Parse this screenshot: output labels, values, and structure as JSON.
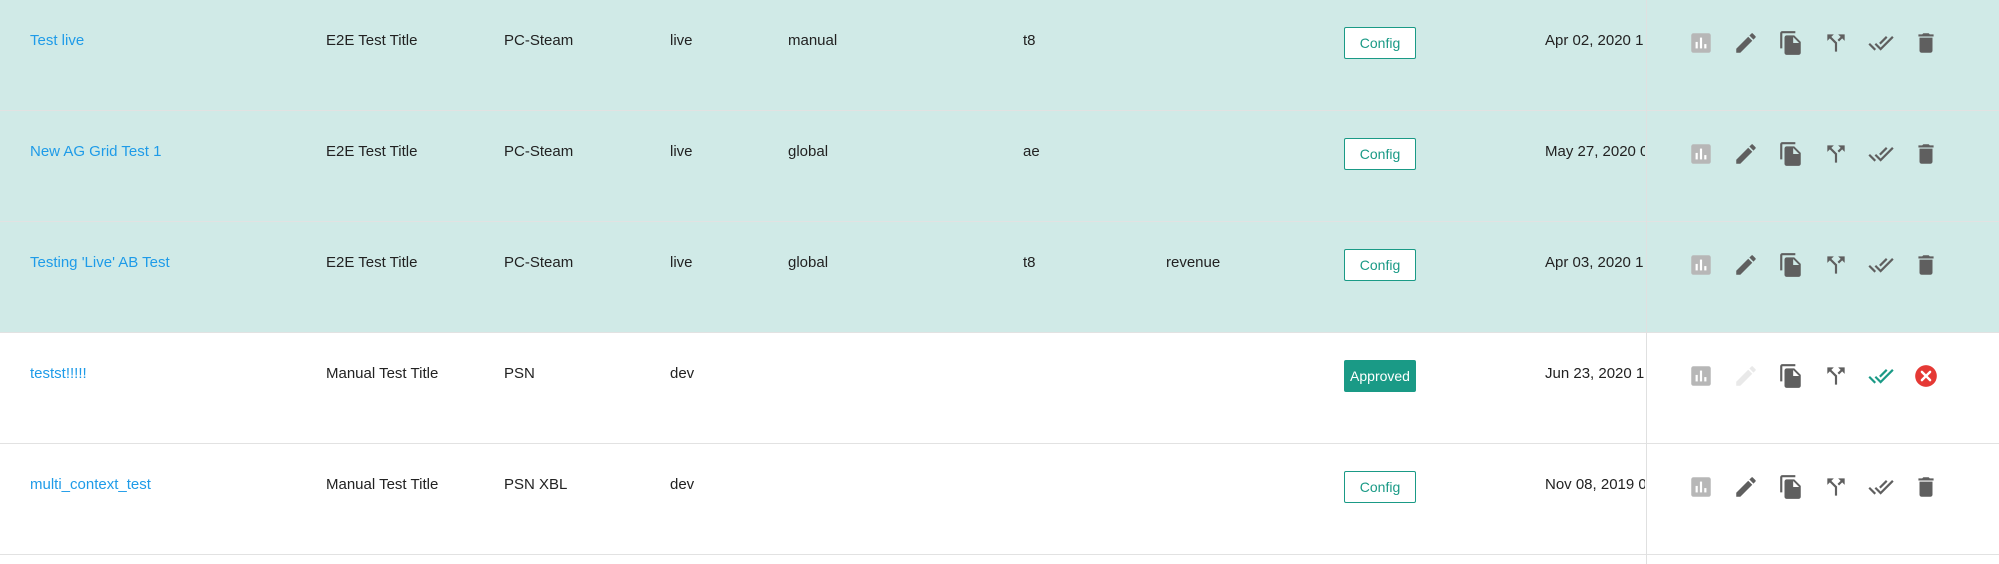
{
  "colors": {
    "link": "#1e9be8",
    "selected_row": "#d0eae7",
    "teal": "#1a9a86",
    "icon": "#5f5f5f",
    "icon_muted": "#b7b7b7",
    "danger": "#e53935"
  },
  "rows": [
    {
      "name": "Test live",
      "title": "E2E Test Title",
      "platform": "PC-Steam",
      "env": "live",
      "scope": "manual",
      "context": "t8",
      "metric": "",
      "status": "Config",
      "date": "Apr 02, 2020 1",
      "selected": true,
      "actions": [
        "stats-icon",
        "edit-icon",
        "copy-icon",
        "fork-icon",
        "approve-icon",
        "delete-icon"
      ]
    },
    {
      "name": "New AG Grid Test 1",
      "title": "E2E Test Title",
      "platform": "PC-Steam",
      "env": "live",
      "scope": "global",
      "context": "ae",
      "metric": "",
      "status": "Config",
      "date": "May 27, 2020 0",
      "selected": true,
      "actions": [
        "stats-icon",
        "edit-icon",
        "copy-icon",
        "fork-icon",
        "approve-icon",
        "delete-icon"
      ]
    },
    {
      "name": "Testing 'Live' AB Test",
      "title": "E2E Test Title",
      "platform": "PC-Steam",
      "env": "live",
      "scope": "global",
      "context": "t8",
      "metric": "revenue",
      "status": "Config",
      "date": "Apr 03, 2020 1",
      "selected": true,
      "actions": [
        "stats-icon",
        "edit-icon",
        "copy-icon",
        "fork-icon",
        "approve-icon",
        "delete-icon"
      ]
    },
    {
      "name": "testst!!!!!",
      "title": "Manual Test Title",
      "platform": "PSN",
      "env": "dev",
      "scope": "",
      "context": "",
      "metric": "",
      "status": "Approved",
      "date": "Jun 23, 2020 1",
      "selected": false,
      "actions": [
        "stats-icon",
        "edit-icon-disabled",
        "copy-icon",
        "fork-icon",
        "approved-icon",
        "cancel-icon"
      ]
    },
    {
      "name": "multi_context_test",
      "title": "Manual Test Title",
      "platform": "PSN XBL",
      "env": "dev",
      "scope": "",
      "context": "",
      "metric": "",
      "status": "Config",
      "date": "Nov 08, 2019 0",
      "selected": false,
      "actions": [
        "stats-icon",
        "edit-icon",
        "copy-icon",
        "fork-icon",
        "approve-icon",
        "delete-icon"
      ]
    }
  ]
}
